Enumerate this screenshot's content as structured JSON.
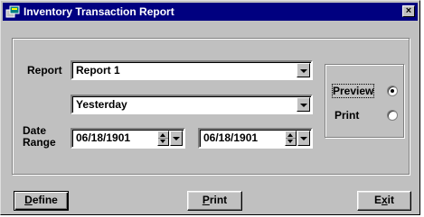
{
  "window": {
    "title": "Inventory Transaction Report",
    "close_glyph": "×",
    "colors": {
      "face": "#c0c0c0",
      "titlebar": "#000080",
      "title_text": "#ffffff"
    }
  },
  "form": {
    "report_label": "Report",
    "report_value": "Report 1",
    "period_value": "Yesterday",
    "date_range_label_line1": "Date",
    "date_range_label_line2": "Range",
    "start_date": "06/18/1901",
    "end_date": "06/18/1901"
  },
  "output": {
    "preview_label": "Preview",
    "print_label": "Print",
    "selected": "Preview"
  },
  "buttons": {
    "define_label_mnemonic": "D",
    "define_label_rest": "efine",
    "print_label_mnemonic": "P",
    "print_label_rest": "rint",
    "exit_label_before": "E",
    "exit_label_mnemonic": "x",
    "exit_label_after": "it"
  }
}
